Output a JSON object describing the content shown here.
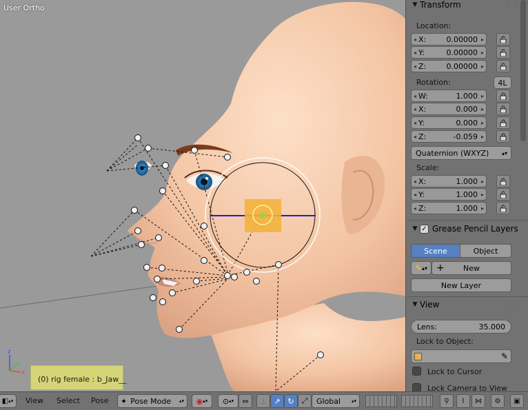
{
  "viewport": {
    "title": "User Ortho",
    "active_object_label": "(0) rig female : b_Jaw__"
  },
  "panel": {
    "transform": {
      "header": "Transform",
      "location_label": "Location:",
      "location": [
        {
          "axis": "X:",
          "value": "0.00000"
        },
        {
          "axis": "Y:",
          "value": "0.00000"
        },
        {
          "axis": "Z:",
          "value": "0.00000"
        }
      ],
      "rotation_label": "Rotation:",
      "rotation_lock_mode": "4L",
      "rotation": [
        {
          "axis": "W:",
          "value": "1.000"
        },
        {
          "axis": "X:",
          "value": "0.000"
        },
        {
          "axis": "Y:",
          "value": "0.000"
        },
        {
          "axis": "Z:",
          "value": "-0.059"
        }
      ],
      "rotation_mode": "Quaternion (WXYZ)",
      "scale_label": "Scale:",
      "scale": [
        {
          "axis": "X:",
          "value": "1.000"
        },
        {
          "axis": "Y:",
          "value": "1.000"
        },
        {
          "axis": "Z:",
          "value": "1.000"
        }
      ]
    },
    "grease_pencil": {
      "header": "Grease Pencil Layers",
      "tab_scene": "Scene",
      "tab_object": "Object",
      "new_label": "New",
      "new_layer_label": "New Layer"
    },
    "view": {
      "header": "View",
      "lens_label": "Lens:",
      "lens_value": "35.000",
      "lock_to_object_label": "Lock to Object:",
      "lock_to_cursor_label": "Lock to Cursor",
      "lock_camera_label": "Lock Camera to View"
    }
  },
  "bottom_bar": {
    "menu_view": "View",
    "menu_select": "Select",
    "menu_pose": "Pose",
    "mode": "Pose Mode",
    "orientation": "Global"
  },
  "colors": {
    "viewport_bg": "#9a9a9a",
    "panel_bg": "#727272",
    "active_tab": "#5680c2",
    "skin": "#f2c7a8",
    "bone_highlight": "#f2b23c"
  }
}
